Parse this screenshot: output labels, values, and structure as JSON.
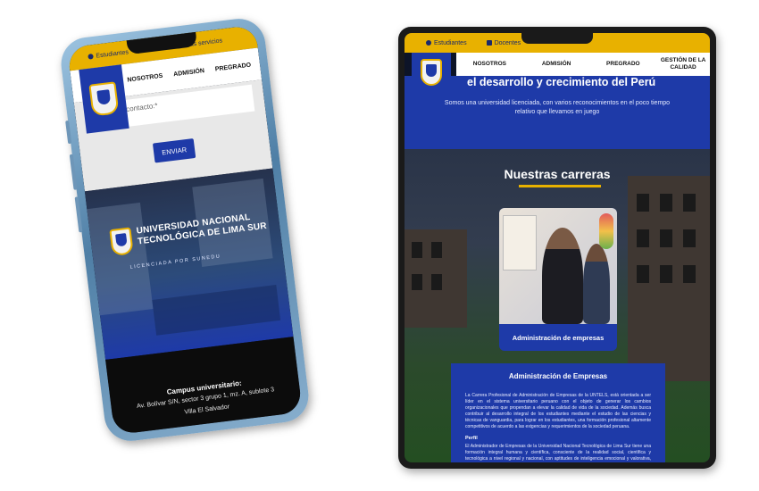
{
  "phone": {
    "topbar": {
      "students": "Estudiantes",
      "teachers": "Docentes",
      "more": "Más servicios"
    },
    "nav": [
      "NOSOTROS",
      "ADMISIÓN",
      "PREGRADO"
    ],
    "form": {
      "textarea_placeholder": "de contacto:*",
      "send": "ENVIAR"
    },
    "university": {
      "name_line1": "UNIVERSIDAD NACIONAL",
      "name_line2": "TECNOLÓGICA DE LIMA SUR",
      "licensed": "LICENCIADA POR SUNEDU"
    },
    "footer": {
      "title": "Campus universitario:",
      "address1": "Av. Bolívar S/N, sector 3 grupo 1, mz. A, sublote 3",
      "address2": "Villa El Salvador"
    }
  },
  "tablet": {
    "topbar": {
      "students": "Estudiantes",
      "teachers": "Docentes"
    },
    "nav": [
      "NOSOTROS",
      "ADMISIÓN",
      "PREGRADO",
      "GESTIÓN DE LA CALIDAD"
    ],
    "hero": {
      "headline": "el desarrollo y crecimiento del Perú",
      "subtext": "Somos una universidad licenciada, con varios reconocimientos en el poco tiempo relativo que llevamos en juego"
    },
    "careers_title": "Nuestras carreras",
    "career_card": {
      "label": "Administración de empresas"
    },
    "detail": {
      "title": "Administración de Empresas",
      "intro": "La Carrera Profesional de Administración de Empresas de la UNTELS, está orientada a ser líder en el sistema universitario peruano con el objeto de generar los cambios organizacionales que propendan a elevar la calidad de vida de la sociedad. Además busca contribuir al desarrollo integral de los estudiantes mediante el estudio de las ciencias y técnicas de vanguardia, para lograr en los estudiantes, una formación profesional altamente competitivos de acuerdo a las exigencias y requerimientos de la sociedad peruana.",
      "profile_heading": "Perfil",
      "profile": "El Administrador de Empresas de la Universidad Nacional Tecnológica de Lima Sur tiene una formación integral humana y científica, consciente de la realidad social, científica y tecnológica a nivel regional y nacional, con aptitudes de inteligencia emocional y valorativa, con habilidades en investigación científico-tecnológica y capacidad productiva,"
    }
  },
  "colors": {
    "gold": "#e8b100",
    "navy": "#1e3aa8"
  }
}
